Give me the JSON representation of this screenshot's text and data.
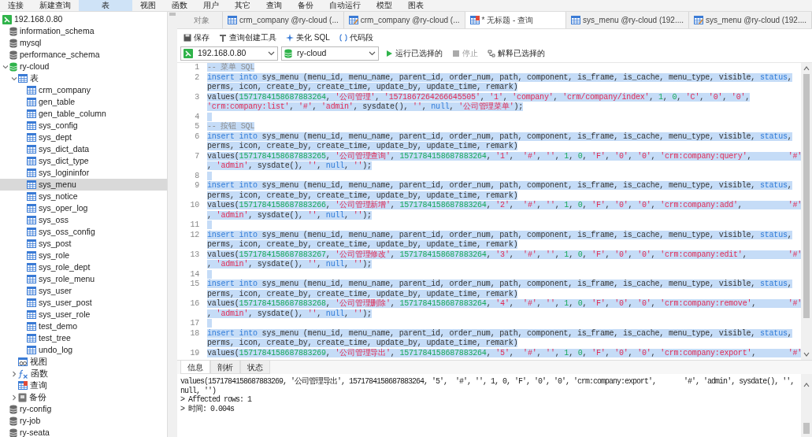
{
  "menu_bar": [
    {
      "label": "连接",
      "selected": false
    },
    {
      "label": "新建查询",
      "selected": false
    },
    {
      "label": "表",
      "selected": true
    },
    {
      "label": "视图",
      "selected": false
    },
    {
      "label": "函数",
      "selected": false
    },
    {
      "label": "用户",
      "selected": false
    },
    {
      "label": "其它",
      "selected": false
    },
    {
      "label": "查询",
      "selected": false
    },
    {
      "label": "备份",
      "selected": false
    },
    {
      "label": "自动运行",
      "selected": false
    },
    {
      "label": "模型",
      "selected": false
    },
    {
      "label": "图表",
      "selected": false
    }
  ],
  "sidebar": {
    "tree": [
      {
        "label": "192.168.0.80",
        "kind": "server",
        "selected": false,
        "children": [
          {
            "label": "information_schema",
            "kind": "database",
            "selected": false
          },
          {
            "label": "mysql",
            "kind": "database",
            "selected": false
          },
          {
            "label": "performance_schema",
            "kind": "database",
            "selected": false
          },
          {
            "label": "ry-cloud",
            "kind": "database-open",
            "selected": false,
            "expanded": true,
            "children": [
              {
                "label": "表",
                "kind": "tables",
                "selected": false,
                "expanded": true,
                "children": [
                  {
                    "label": "crm_company",
                    "kind": "table",
                    "selected": false
                  },
                  {
                    "label": "gen_table",
                    "kind": "table",
                    "selected": false
                  },
                  {
                    "label": "gen_table_column",
                    "kind": "table",
                    "selected": false
                  },
                  {
                    "label": "sys_config",
                    "kind": "table",
                    "selected": false
                  },
                  {
                    "label": "sys_dept",
                    "kind": "table",
                    "selected": false
                  },
                  {
                    "label": "sys_dict_data",
                    "kind": "table",
                    "selected": false
                  },
                  {
                    "label": "sys_dict_type",
                    "kind": "table",
                    "selected": false
                  },
                  {
                    "label": "sys_logininfor",
                    "kind": "table",
                    "selected": false
                  },
                  {
                    "label": "sys_menu",
                    "kind": "table",
                    "selected": true
                  },
                  {
                    "label": "sys_notice",
                    "kind": "table",
                    "selected": false
                  },
                  {
                    "label": "sys_oper_log",
                    "kind": "table",
                    "selected": false
                  },
                  {
                    "label": "sys_oss",
                    "kind": "table",
                    "selected": false
                  },
                  {
                    "label": "sys_oss_config",
                    "kind": "table",
                    "selected": false
                  },
                  {
                    "label": "sys_post",
                    "kind": "table",
                    "selected": false
                  },
                  {
                    "label": "sys_role",
                    "kind": "table",
                    "selected": false
                  },
                  {
                    "label": "sys_role_dept",
                    "kind": "table",
                    "selected": false
                  },
                  {
                    "label": "sys_role_menu",
                    "kind": "table",
                    "selected": false
                  },
                  {
                    "label": "sys_user",
                    "kind": "table",
                    "selected": false
                  },
                  {
                    "label": "sys_user_post",
                    "kind": "table",
                    "selected": false
                  },
                  {
                    "label": "sys_user_role",
                    "kind": "table",
                    "selected": false
                  },
                  {
                    "label": "test_demo",
                    "kind": "table",
                    "selected": false
                  },
                  {
                    "label": "test_tree",
                    "kind": "table",
                    "selected": false
                  },
                  {
                    "label": "undo_log",
                    "kind": "table",
                    "selected": false
                  }
                ]
              },
              {
                "label": "视图",
                "kind": "view",
                "selected": false
              },
              {
                "label": "函数",
                "kind": "function",
                "selected": false,
                "expanded": false
              },
              {
                "label": "查询",
                "kind": "query",
                "selected": false
              },
              {
                "label": "备份",
                "kind": "backup",
                "selected": false,
                "expanded": false
              }
            ]
          },
          {
            "label": "ry-config",
            "kind": "database",
            "selected": false
          },
          {
            "label": "ry-job",
            "kind": "database",
            "selected": false
          },
          {
            "label": "ry-seata",
            "kind": "database",
            "selected": false
          }
        ]
      }
    ]
  },
  "tabs": [
    {
      "label": "对象",
      "kind": "plain",
      "selected": false
    },
    {
      "label": "crm_company @ry-cloud (...",
      "kind": "table",
      "selected": false
    },
    {
      "label": "crm_company @ry-cloud (...",
      "kind": "design",
      "selected": false
    },
    {
      "label": "* 无标题 - 查询",
      "kind": "query",
      "selected": true
    },
    {
      "label": "sys_menu @ry-cloud (192....",
      "kind": "table",
      "selected": false
    },
    {
      "label": "sys_menu @ry-cloud (192....",
      "kind": "design",
      "selected": false
    }
  ],
  "toolbar": [
    {
      "label": "保存",
      "kind": "save"
    },
    {
      "label": "查询创建工具",
      "kind": "builder"
    },
    {
      "label": "美化 SQL",
      "kind": "beautify"
    },
    {
      "label": "代码段",
      "kind": "snippet"
    }
  ],
  "connection": {
    "value": "192.168.0.80"
  },
  "database": {
    "value": "ry-cloud"
  },
  "actions": [
    {
      "label": "运行已选择的",
      "kind": "run",
      "disabled": false
    },
    {
      "label": "停止",
      "kind": "stop",
      "disabled": true
    },
    {
      "label": "解释已选择的",
      "kind": "explain",
      "disabled": false
    }
  ],
  "editor": {
    "lines": [
      {
        "number": "1",
        "selected": true,
        "rows": [
          {
            "segments": [
              {
                "kind": "comment",
                "text": "-- 菜单 SQL"
              }
            ]
          }
        ]
      },
      {
        "number": "2",
        "selected": true,
        "rows": [
          {
            "segments": [
              {
                "kind": "keyword",
                "text": "insert into"
              },
              {
                "kind": "plain",
                "text": " sys_menu (menu_id, menu_name, parent_id, order_num, path, component, is_frame, is_cache, menu_type, visible, "
              },
              {
                "kind": "keyword",
                "text": "status"
              },
              {
                "kind": "plain",
                "text": ","
              }
            ]
          },
          {
            "segments": [
              {
                "kind": "plain",
                "text": "perms, icon, create_by, create_time, update_by, update_time, remark)"
              }
            ]
          }
        ]
      },
      {
        "number": "3",
        "selected": true,
        "rows": [
          {
            "segments": [
              {
                "kind": "plain",
                "text": "values("
              },
              {
                "kind": "number",
                "text": "1571784158687883264"
              },
              {
                "kind": "plain",
                "text": ", "
              },
              {
                "kind": "string",
                "text": "'公司管理'"
              },
              {
                "kind": "plain",
                "text": ", "
              },
              {
                "kind": "string",
                "text": "'1571867264266645505'"
              },
              {
                "kind": "plain",
                "text": ", "
              },
              {
                "kind": "string",
                "text": "'1'"
              },
              {
                "kind": "plain",
                "text": ", "
              },
              {
                "kind": "string",
                "text": "'company'"
              },
              {
                "kind": "plain",
                "text": ", "
              },
              {
                "kind": "string",
                "text": "'crm/company/index'"
              },
              {
                "kind": "plain",
                "text": ", "
              },
              {
                "kind": "number",
                "text": "1"
              },
              {
                "kind": "plain",
                "text": ", "
              },
              {
                "kind": "number",
                "text": "0"
              },
              {
                "kind": "plain",
                "text": ", "
              },
              {
                "kind": "string",
                "text": "'C'"
              },
              {
                "kind": "plain",
                "text": ", "
              },
              {
                "kind": "string",
                "text": "'0'"
              },
              {
                "kind": "plain",
                "text": ", "
              },
              {
                "kind": "string",
                "text": "'0'"
              },
              {
                "kind": "plain",
                "text": ","
              }
            ]
          },
          {
            "segments": [
              {
                "kind": "string",
                "text": "'crm:company:list'"
              },
              {
                "kind": "plain",
                "text": ", "
              },
              {
                "kind": "string",
                "text": "'#'"
              },
              {
                "kind": "plain",
                "text": ", "
              },
              {
                "kind": "string",
                "text": "'admin'"
              },
              {
                "kind": "plain",
                "text": ", sysdate(), "
              },
              {
                "kind": "string",
                "text": "''"
              },
              {
                "kind": "plain",
                "text": ", "
              },
              {
                "kind": "keyword",
                "text": "null"
              },
              {
                "kind": "plain",
                "text": ", "
              },
              {
                "kind": "string",
                "text": "'公司管理菜单'"
              },
              {
                "kind": "plain",
                "text": ");"
              }
            ]
          }
        ]
      },
      {
        "number": "4",
        "selected": true,
        "rows": [
          {
            "segments": []
          }
        ]
      },
      {
        "number": "5",
        "selected": true,
        "rows": [
          {
            "segments": [
              {
                "kind": "comment",
                "text": "-- 按钮 SQL"
              }
            ]
          }
        ]
      },
      {
        "number": "6",
        "selected": true,
        "rows": [
          {
            "segments": [
              {
                "kind": "keyword",
                "text": "insert into"
              },
              {
                "kind": "plain",
                "text": " sys_menu (menu_id, menu_name, parent_id, order_num, path, component, is_frame, is_cache, menu_type, visible, "
              },
              {
                "kind": "keyword",
                "text": "status"
              },
              {
                "kind": "plain",
                "text": ","
              }
            ]
          },
          {
            "segments": [
              {
                "kind": "plain",
                "text": "perms, icon, create_by, create_time, update_by, update_time, remark)"
              }
            ]
          }
        ]
      },
      {
        "number": "7",
        "selected": true,
        "rows": [
          {
            "segments": [
              {
                "kind": "plain",
                "text": "values("
              },
              {
                "kind": "number",
                "text": "1571784158687883265"
              },
              {
                "kind": "plain",
                "text": ", "
              },
              {
                "kind": "string",
                "text": "'公司管理查询'"
              },
              {
                "kind": "plain",
                "text": ", "
              },
              {
                "kind": "number",
                "text": "1571784158687883264"
              },
              {
                "kind": "plain",
                "text": ", "
              },
              {
                "kind": "string",
                "text": "'1'"
              },
              {
                "kind": "plain",
                "text": ",  "
              },
              {
                "kind": "string",
                "text": "'#'"
              },
              {
                "kind": "plain",
                "text": ", "
              },
              {
                "kind": "string",
                "text": "''"
              },
              {
                "kind": "plain",
                "text": ", "
              },
              {
                "kind": "number",
                "text": "1"
              },
              {
                "kind": "plain",
                "text": ", "
              },
              {
                "kind": "number",
                "text": "0"
              },
              {
                "kind": "plain",
                "text": ", "
              },
              {
                "kind": "string",
                "text": "'F'"
              },
              {
                "kind": "plain",
                "text": ", "
              },
              {
                "kind": "string",
                "text": "'0'"
              },
              {
                "kind": "plain",
                "text": ", "
              },
              {
                "kind": "string",
                "text": "'0'"
              },
              {
                "kind": "plain",
                "text": ", "
              },
              {
                "kind": "string",
                "text": "'crm:company:query'"
              },
              {
                "kind": "plain",
                "text": ",        "
              },
              {
                "kind": "string",
                "text": "'#'"
              }
            ]
          },
          {
            "segments": [
              {
                "kind": "plain",
                "text": ", "
              },
              {
                "kind": "string",
                "text": "'admin'"
              },
              {
                "kind": "plain",
                "text": ", sysdate(), "
              },
              {
                "kind": "string",
                "text": "''"
              },
              {
                "kind": "plain",
                "text": ", "
              },
              {
                "kind": "keyword",
                "text": "null"
              },
              {
                "kind": "plain",
                "text": ", "
              },
              {
                "kind": "string",
                "text": "''"
              },
              {
                "kind": "plain",
                "text": ");"
              }
            ]
          }
        ]
      },
      {
        "number": "8",
        "selected": true,
        "rows": [
          {
            "segments": []
          }
        ]
      },
      {
        "number": "9",
        "selected": true,
        "rows": [
          {
            "segments": [
              {
                "kind": "keyword",
                "text": "insert into"
              },
              {
                "kind": "plain",
                "text": " sys_menu (menu_id, menu_name, parent_id, order_num, path, component, is_frame, is_cache, menu_type, visible, "
              },
              {
                "kind": "keyword",
                "text": "status"
              },
              {
                "kind": "plain",
                "text": ","
              }
            ]
          },
          {
            "segments": [
              {
                "kind": "plain",
                "text": "perms, icon, create_by, create_time, update_by, update_time, remark)"
              }
            ]
          }
        ]
      },
      {
        "number": "10",
        "selected": true,
        "rows": [
          {
            "segments": [
              {
                "kind": "plain",
                "text": "values("
              },
              {
                "kind": "number",
                "text": "1571784158687883266"
              },
              {
                "kind": "plain",
                "text": ", "
              },
              {
                "kind": "string",
                "text": "'公司管理新增'"
              },
              {
                "kind": "plain",
                "text": ", "
              },
              {
                "kind": "number",
                "text": "1571784158687883264"
              },
              {
                "kind": "plain",
                "text": ", "
              },
              {
                "kind": "string",
                "text": "'2'"
              },
              {
                "kind": "plain",
                "text": ",  "
              },
              {
                "kind": "string",
                "text": "'#'"
              },
              {
                "kind": "plain",
                "text": ", "
              },
              {
                "kind": "string",
                "text": "''"
              },
              {
                "kind": "plain",
                "text": ", "
              },
              {
                "kind": "number",
                "text": "1"
              },
              {
                "kind": "plain",
                "text": ", "
              },
              {
                "kind": "number",
                "text": "0"
              },
              {
                "kind": "plain",
                "text": ", "
              },
              {
                "kind": "string",
                "text": "'F'"
              },
              {
                "kind": "plain",
                "text": ", "
              },
              {
                "kind": "string",
                "text": "'0'"
              },
              {
                "kind": "plain",
                "text": ", "
              },
              {
                "kind": "string",
                "text": "'0'"
              },
              {
                "kind": "plain",
                "text": ", "
              },
              {
                "kind": "string",
                "text": "'crm:company:add'"
              },
              {
                "kind": "plain",
                "text": ",          "
              },
              {
                "kind": "string",
                "text": "'#'"
              }
            ]
          },
          {
            "segments": [
              {
                "kind": "plain",
                "text": ", "
              },
              {
                "kind": "string",
                "text": "'admin'"
              },
              {
                "kind": "plain",
                "text": ", sysdate(), "
              },
              {
                "kind": "string",
                "text": "''"
              },
              {
                "kind": "plain",
                "text": ", "
              },
              {
                "kind": "keyword",
                "text": "null"
              },
              {
                "kind": "plain",
                "text": ", "
              },
              {
                "kind": "string",
                "text": "''"
              },
              {
                "kind": "plain",
                "text": ");"
              }
            ]
          }
        ]
      },
      {
        "number": "11",
        "selected": true,
        "rows": [
          {
            "segments": []
          }
        ]
      },
      {
        "number": "12",
        "selected": true,
        "rows": [
          {
            "segments": [
              {
                "kind": "keyword",
                "text": "insert into"
              },
              {
                "kind": "plain",
                "text": " sys_menu (menu_id, menu_name, parent_id, order_num, path, component, is_frame, is_cache, menu_type, visible, "
              },
              {
                "kind": "keyword",
                "text": "status"
              },
              {
                "kind": "plain",
                "text": ","
              }
            ]
          },
          {
            "segments": [
              {
                "kind": "plain",
                "text": "perms, icon, create_by, create_time, update_by, update_time, remark)"
              }
            ]
          }
        ]
      },
      {
        "number": "13",
        "selected": true,
        "rows": [
          {
            "segments": [
              {
                "kind": "plain",
                "text": "values("
              },
              {
                "kind": "number",
                "text": "1571784158687883267"
              },
              {
                "kind": "plain",
                "text": ", "
              },
              {
                "kind": "string",
                "text": "'公司管理修改'"
              },
              {
                "kind": "plain",
                "text": ", "
              },
              {
                "kind": "number",
                "text": "1571784158687883264"
              },
              {
                "kind": "plain",
                "text": ", "
              },
              {
                "kind": "string",
                "text": "'3'"
              },
              {
                "kind": "plain",
                "text": ",  "
              },
              {
                "kind": "string",
                "text": "'#'"
              },
              {
                "kind": "plain",
                "text": ", "
              },
              {
                "kind": "string",
                "text": "''"
              },
              {
                "kind": "plain",
                "text": ", "
              },
              {
                "kind": "number",
                "text": "1"
              },
              {
                "kind": "plain",
                "text": ", "
              },
              {
                "kind": "number",
                "text": "0"
              },
              {
                "kind": "plain",
                "text": ", "
              },
              {
                "kind": "string",
                "text": "'F'"
              },
              {
                "kind": "plain",
                "text": ", "
              },
              {
                "kind": "string",
                "text": "'0'"
              },
              {
                "kind": "plain",
                "text": ", "
              },
              {
                "kind": "string",
                "text": "'0'"
              },
              {
                "kind": "plain",
                "text": ", "
              },
              {
                "kind": "string",
                "text": "'crm:company:edit'"
              },
              {
                "kind": "plain",
                "text": ",         "
              },
              {
                "kind": "string",
                "text": "'#'"
              }
            ]
          },
          {
            "segments": [
              {
                "kind": "plain",
                "text": ", "
              },
              {
                "kind": "string",
                "text": "'admin'"
              },
              {
                "kind": "plain",
                "text": ", sysdate(), "
              },
              {
                "kind": "string",
                "text": "''"
              },
              {
                "kind": "plain",
                "text": ", "
              },
              {
                "kind": "keyword",
                "text": "null"
              },
              {
                "kind": "plain",
                "text": ", "
              },
              {
                "kind": "string",
                "text": "''"
              },
              {
                "kind": "plain",
                "text": ");"
              }
            ]
          }
        ]
      },
      {
        "number": "14",
        "selected": true,
        "rows": [
          {
            "segments": []
          }
        ]
      },
      {
        "number": "15",
        "selected": true,
        "rows": [
          {
            "segments": [
              {
                "kind": "keyword",
                "text": "insert into"
              },
              {
                "kind": "plain",
                "text": " sys_menu (menu_id, menu_name, parent_id, order_num, path, component, is_frame, is_cache, menu_type, visible, "
              },
              {
                "kind": "keyword",
                "text": "status"
              },
              {
                "kind": "plain",
                "text": ","
              }
            ]
          },
          {
            "segments": [
              {
                "kind": "plain",
                "text": "perms, icon, create_by, create_time, update_by, update_time, remark)"
              }
            ]
          }
        ]
      },
      {
        "number": "16",
        "selected": true,
        "rows": [
          {
            "segments": [
              {
                "kind": "plain",
                "text": "values("
              },
              {
                "kind": "number",
                "text": "1571784158687883268"
              },
              {
                "kind": "plain",
                "text": ", "
              },
              {
                "kind": "string",
                "text": "'公司管理删除'"
              },
              {
                "kind": "plain",
                "text": ", "
              },
              {
                "kind": "number",
                "text": "1571784158687883264"
              },
              {
                "kind": "plain",
                "text": ", "
              },
              {
                "kind": "string",
                "text": "'4'"
              },
              {
                "kind": "plain",
                "text": ",  "
              },
              {
                "kind": "string",
                "text": "'#'"
              },
              {
                "kind": "plain",
                "text": ", "
              },
              {
                "kind": "string",
                "text": "''"
              },
              {
                "kind": "plain",
                "text": ", "
              },
              {
                "kind": "number",
                "text": "1"
              },
              {
                "kind": "plain",
                "text": ", "
              },
              {
                "kind": "number",
                "text": "0"
              },
              {
                "kind": "plain",
                "text": ", "
              },
              {
                "kind": "string",
                "text": "'F'"
              },
              {
                "kind": "plain",
                "text": ", "
              },
              {
                "kind": "string",
                "text": "'0'"
              },
              {
                "kind": "plain",
                "text": ", "
              },
              {
                "kind": "string",
                "text": "'0'"
              },
              {
                "kind": "plain",
                "text": ", "
              },
              {
                "kind": "string",
                "text": "'crm:company:remove'"
              },
              {
                "kind": "plain",
                "text": ",       "
              },
              {
                "kind": "string",
                "text": "'#'"
              }
            ]
          },
          {
            "segments": [
              {
                "kind": "plain",
                "text": ", "
              },
              {
                "kind": "string",
                "text": "'admin'"
              },
              {
                "kind": "plain",
                "text": ", sysdate(), "
              },
              {
                "kind": "string",
                "text": "''"
              },
              {
                "kind": "plain",
                "text": ", "
              },
              {
                "kind": "keyword",
                "text": "null"
              },
              {
                "kind": "plain",
                "text": ", "
              },
              {
                "kind": "string",
                "text": "''"
              },
              {
                "kind": "plain",
                "text": ");"
              }
            ]
          }
        ]
      },
      {
        "number": "17",
        "selected": true,
        "rows": [
          {
            "segments": []
          }
        ]
      },
      {
        "number": "18",
        "selected": true,
        "rows": [
          {
            "segments": [
              {
                "kind": "keyword",
                "text": "insert into"
              },
              {
                "kind": "plain",
                "text": " sys_menu (menu_id, menu_name, parent_id, order_num, path, component, is_frame, is_cache, menu_type, visible, "
              },
              {
                "kind": "keyword",
                "text": "status"
              },
              {
                "kind": "plain",
                "text": ","
              }
            ]
          },
          {
            "segments": [
              {
                "kind": "plain",
                "text": "perms, icon, create_by, create_time, update_by, update_time, remark)"
              }
            ]
          }
        ]
      },
      {
        "number": "19",
        "selected": true,
        "rows": [
          {
            "segments": [
              {
                "kind": "plain",
                "text": "values("
              },
              {
                "kind": "number",
                "text": "1571784158687883269"
              },
              {
                "kind": "plain",
                "text": ", "
              },
              {
                "kind": "string",
                "text": "'公司管理导出'"
              },
              {
                "kind": "plain",
                "text": ", "
              },
              {
                "kind": "number",
                "text": "1571784158687883264"
              },
              {
                "kind": "plain",
                "text": ", "
              },
              {
                "kind": "string",
                "text": "'5'"
              },
              {
                "kind": "plain",
                "text": ",  "
              },
              {
                "kind": "string",
                "text": "'#'"
              },
              {
                "kind": "plain",
                "text": ", "
              },
              {
                "kind": "string",
                "text": "''"
              },
              {
                "kind": "plain",
                "text": ", "
              },
              {
                "kind": "number",
                "text": "1"
              },
              {
                "kind": "plain",
                "text": ", "
              },
              {
                "kind": "number",
                "text": "0"
              },
              {
                "kind": "plain",
                "text": ", "
              },
              {
                "kind": "string",
                "text": "'F'"
              },
              {
                "kind": "plain",
                "text": ", "
              },
              {
                "kind": "string",
                "text": "'0'"
              },
              {
                "kind": "plain",
                "text": ", "
              },
              {
                "kind": "string",
                "text": "'0'"
              },
              {
                "kind": "plain",
                "text": ", "
              },
              {
                "kind": "string",
                "text": "'crm:company:export'"
              },
              {
                "kind": "plain",
                "text": ",       "
              },
              {
                "kind": "string",
                "text": "'#'"
              }
            ]
          }
        ]
      }
    ]
  },
  "result_tabs": [
    {
      "label": "信息",
      "selected": true
    },
    {
      "label": "剖析",
      "selected": false
    },
    {
      "label": "状态",
      "selected": false
    }
  ],
  "messages": [
    "values(1571784158687883269, '公司管理导出', 1571784158687883264, '5',  '#', '', 1, 0, 'F', '0', '0', 'crm:company:export',       '#', 'admin', sysdate(), '',",
    "null, '')",
    "> Affected rows: 1",
    "> 时间: 0.004s"
  ]
}
